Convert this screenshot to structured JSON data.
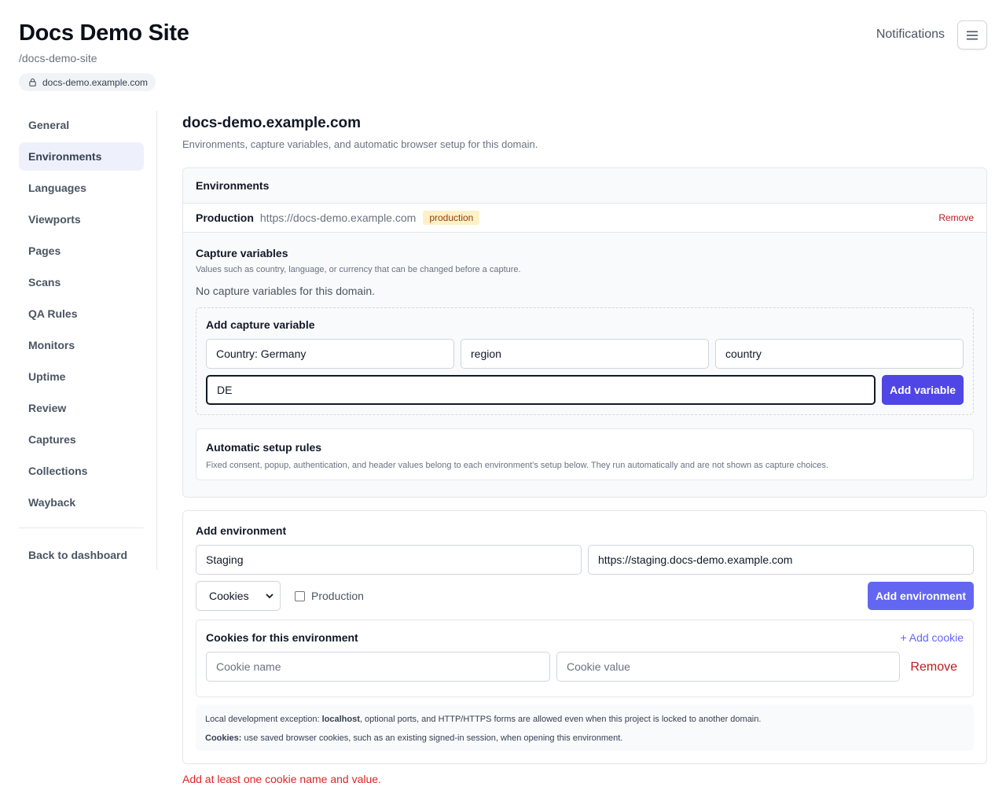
{
  "header": {
    "title": "Docs Demo Site",
    "slug": "/docs-demo-site",
    "domain": "docs-demo.example.com",
    "notifications_label": "Notifications"
  },
  "sidebar": {
    "items": [
      {
        "label": "General",
        "active": false
      },
      {
        "label": "Environments",
        "active": true
      },
      {
        "label": "Languages",
        "active": false
      },
      {
        "label": "Viewports",
        "active": false
      },
      {
        "label": "Pages",
        "active": false
      },
      {
        "label": "Scans",
        "active": false
      },
      {
        "label": "QA Rules",
        "active": false
      },
      {
        "label": "Monitors",
        "active": false
      },
      {
        "label": "Uptime",
        "active": false
      },
      {
        "label": "Review",
        "active": false
      },
      {
        "label": "Captures",
        "active": false
      },
      {
        "label": "Collections",
        "active": false
      },
      {
        "label": "Wayback",
        "active": false
      }
    ],
    "back_label": "Back to dashboard"
  },
  "main": {
    "title": "docs-demo.example.com",
    "subtitle": "Environments, capture variables, and automatic browser setup for this domain.",
    "environments": {
      "heading": "Environments",
      "entry": {
        "name": "Production",
        "url": "https://docs-demo.example.com",
        "badge": "production",
        "remove_label": "Remove"
      },
      "capture": {
        "title": "Capture variables",
        "description": "Values such as country, language, or currency that can be changed before a capture.",
        "empty": "No capture variables for this domain.",
        "add": {
          "title": "Add capture variable",
          "label_value": "Country: Germany",
          "group_value": "region",
          "key_value": "country",
          "value_value": "DE",
          "button": "Add variable"
        }
      },
      "auto_rules": {
        "title": "Automatic setup rules",
        "description": "Fixed consent, popup, authentication, and header values belong to each environment's setup below. They run automatically and are not shown as capture choices."
      }
    },
    "add_environment": {
      "title": "Add environment",
      "name_value": "Staging",
      "url_value": "https://staging.docs-demo.example.com",
      "setup_select": "Cookies",
      "production_label": "Production",
      "production_checked": false,
      "button": "Add environment",
      "cookies": {
        "title": "Cookies for this environment",
        "add_label": "+ Add cookie",
        "name_placeholder": "Cookie name",
        "value_placeholder": "Cookie value",
        "remove_label": "Remove"
      },
      "notes": {
        "local_prefix": "Local development exception: ",
        "local_bold": "localhost",
        "local_rest": ", optional ports, and HTTP/HTTPS forms are allowed even when this project is locked to another domain.",
        "cookies_bold": "Cookies:",
        "cookies_rest": " use saved browser cookies, such as an existing signed-in session, when opening this environment."
      }
    },
    "error": "Add at least one cookie name and value."
  },
  "colors": {
    "accent": "#4f46e5",
    "error": "#dc2626",
    "badge_bg": "#fdf1c7"
  }
}
